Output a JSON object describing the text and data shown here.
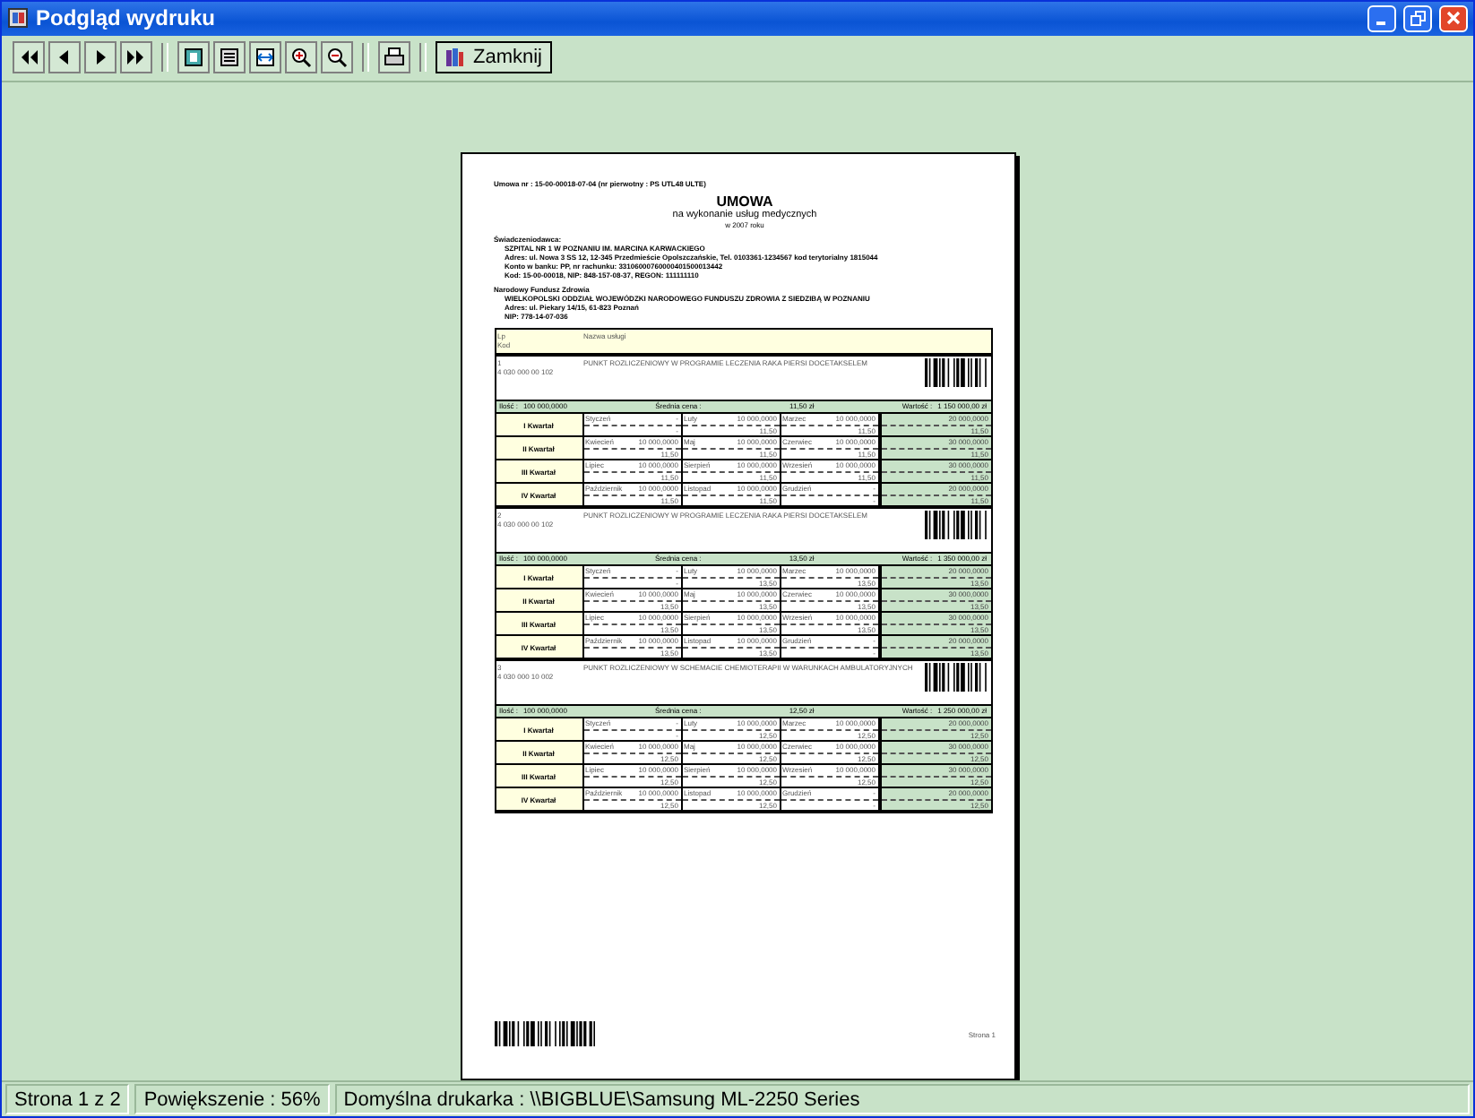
{
  "window": {
    "title": "Podgląd wydruku"
  },
  "toolbar": [
    {
      "kind": "first"
    },
    {
      "kind": "prev"
    },
    {
      "kind": "next"
    },
    {
      "kind": "last"
    },
    {
      "kind": "separator"
    },
    {
      "kind": "one-page"
    },
    {
      "kind": "two-page"
    },
    {
      "kind": "fit"
    },
    {
      "kind": "zoom-in"
    },
    {
      "kind": "zoom-out"
    },
    {
      "kind": "separator"
    },
    {
      "kind": "print"
    },
    {
      "kind": "separator"
    },
    {
      "kind": "close",
      "label": "Zamknij"
    }
  ],
  "document": {
    "reference": "Umowa nr : 15-00-00018-07-04 (nr pierwotny : PS UTL48 ULTE)",
    "title": "UMOWA",
    "subtitle": "na wykonanie usług medycznych",
    "year": "w 2007 roku",
    "provider": {
      "heading": "Świadczeniodawca:",
      "lines": [
        "SZPITAL NR 1 W POZNANIU IM. MARCINA KARWACKIEGO",
        "Adres: ul. Nowa 3 SS 12, 12-345 Przedmieście Opolszczańskie, Tel. 0103361-1234567    kod terytorialny 1815044",
        "Konto w banku: PP, nr rachunku: 33106000760000401500013442",
        "Kod: 15-00-00018, NIP: 848-157-08-37, REGON: 111111110"
      ]
    },
    "payer": {
      "heading": "Narodowy Fundusz Zdrowia",
      "lines": [
        "WIELKOPOLSKI ODDZIAŁ WOJEWÓDZKI NARODOWEGO FUNDUSZU ZDROWIA Z SIEDZIBĄ W POZNANIU",
        "Adres: ul. Piekary 14/15, 61-823 Poznań",
        "NIP: 778-14-07-036"
      ]
    },
    "table": {
      "columns": [
        "Lp",
        "Kod",
        "Nazwa usługi"
      ],
      "items": [
        {
          "lp": "1",
          "code": "4 030 000 00 102",
          "name": "PUNKT ROZLICZENIOWY W PROGRAMIE LECZENIA RAKA PIERSI DOCETAKSELEM",
          "qty_label": "Ilość :",
          "qty": "100 000,0000",
          "avg_label": "Średnia cena :",
          "avg": "11,50 zł",
          "value_label": "Wartość :",
          "value": "1 150 000,00 zł",
          "quarters": [
            {
              "label": "I Kwartał",
              "total_qty": "20 000,0000",
              "total_price": "11,50",
              "months": [
                {
                  "month": "Styczeń",
                  "qty": "-",
                  "price": "-"
                },
                {
                  "month": "Luty",
                  "qty": "10 000,0000",
                  "price": "11,50"
                },
                {
                  "month": "Marzec",
                  "qty": "10 000,0000",
                  "price": "11,50"
                }
              ]
            },
            {
              "label": "II Kwartał",
              "total_qty": "30 000,0000",
              "total_price": "11,50",
              "months": [
                {
                  "month": "Kwiecień",
                  "qty": "10 000,0000",
                  "price": "11,50"
                },
                {
                  "month": "Maj",
                  "qty": "10 000,0000",
                  "price": "11,50"
                },
                {
                  "month": "Czerwiec",
                  "qty": "10 000,0000",
                  "price": "11,50"
                }
              ]
            },
            {
              "label": "III Kwartał",
              "total_qty": "30 000,0000",
              "total_price": "11,50",
              "months": [
                {
                  "month": "Lipiec",
                  "qty": "10 000,0000",
                  "price": "11,50"
                },
                {
                  "month": "Sierpień",
                  "qty": "10 000,0000",
                  "price": "11,50"
                },
                {
                  "month": "Wrzesień",
                  "qty": "10 000,0000",
                  "price": "11,50"
                }
              ]
            },
            {
              "label": "IV Kwartał",
              "total_qty": "20 000,0000",
              "total_price": "11,50",
              "months": [
                {
                  "month": "Październik",
                  "qty": "10 000,0000",
                  "price": "11,50"
                },
                {
                  "month": "Listopad",
                  "qty": "10 000,0000",
                  "price": "11,50"
                },
                {
                  "month": "Grudzień",
                  "qty": "-",
                  "price": "-"
                }
              ]
            }
          ]
        },
        {
          "lp": "2",
          "code": "4 030 000 00 102",
          "name": "PUNKT ROZLICZENIOWY W PROGRAMIE LECZENIA RAKA PIERSI DOCETAKSELEM",
          "qty_label": "Ilość :",
          "qty": "100 000,0000",
          "avg_label": "Średnia cena :",
          "avg": "13,50 zł",
          "value_label": "Wartość :",
          "value": "1 350 000,00 zł",
          "quarters": [
            {
              "label": "I Kwartał",
              "total_qty": "20 000,0000",
              "total_price": "13,50",
              "months": [
                {
                  "month": "Styczeń",
                  "qty": "-",
                  "price": "-"
                },
                {
                  "month": "Luty",
                  "qty": "10 000,0000",
                  "price": "13,50"
                },
                {
                  "month": "Marzec",
                  "qty": "10 000,0000",
                  "price": "13,50"
                }
              ]
            },
            {
              "label": "II Kwartał",
              "total_qty": "30 000,0000",
              "total_price": "13,50",
              "months": [
                {
                  "month": "Kwiecień",
                  "qty": "10 000,0000",
                  "price": "13,50"
                },
                {
                  "month": "Maj",
                  "qty": "10 000,0000",
                  "price": "13,50"
                },
                {
                  "month": "Czerwiec",
                  "qty": "10 000,0000",
                  "price": "13,50"
                }
              ]
            },
            {
              "label": "III Kwartał",
              "total_qty": "30 000,0000",
              "total_price": "13,50",
              "months": [
                {
                  "month": "Lipiec",
                  "qty": "10 000,0000",
                  "price": "13,50"
                },
                {
                  "month": "Sierpień",
                  "qty": "10 000,0000",
                  "price": "13,50"
                },
                {
                  "month": "Wrzesień",
                  "qty": "10 000,0000",
                  "price": "13,50"
                }
              ]
            },
            {
              "label": "IV Kwartał",
              "total_qty": "20 000,0000",
              "total_price": "13,50",
              "months": [
                {
                  "month": "Październik",
                  "qty": "10 000,0000",
                  "price": "13,50"
                },
                {
                  "month": "Listopad",
                  "qty": "10 000,0000",
                  "price": "13,50"
                },
                {
                  "month": "Grudzień",
                  "qty": "-",
                  "price": "-"
                }
              ]
            }
          ]
        },
        {
          "lp": "3",
          "code": "4 030 000 10 002",
          "name": "PUNKT ROZLICZENIOWY W SCHEMACIE CHEMIOTERAPII W WARUNKACH AMBULATORYJNYCH",
          "qty_label": "Ilość :",
          "qty": "100 000,0000",
          "avg_label": "Średnia cena :",
          "avg": "12,50 zł",
          "value_label": "Wartość :",
          "value": "1 250 000,00 zł",
          "quarters": [
            {
              "label": "I Kwartał",
              "total_qty": "20 000,0000",
              "total_price": "12,50",
              "months": [
                {
                  "month": "Styczeń",
                  "qty": "-",
                  "price": "-"
                },
                {
                  "month": "Luty",
                  "qty": "10 000,0000",
                  "price": "12,50"
                },
                {
                  "month": "Marzec",
                  "qty": "10 000,0000",
                  "price": "12,50"
                }
              ]
            },
            {
              "label": "II Kwartał",
              "total_qty": "30 000,0000",
              "total_price": "12,50",
              "months": [
                {
                  "month": "Kwiecień",
                  "qty": "10 000,0000",
                  "price": "12,50"
                },
                {
                  "month": "Maj",
                  "qty": "10 000,0000",
                  "price": "12,50"
                },
                {
                  "month": "Czerwiec",
                  "qty": "10 000,0000",
                  "price": "12,50"
                }
              ]
            },
            {
              "label": "III Kwartał",
              "total_qty": "30 000,0000",
              "total_price": "12,50",
              "months": [
                {
                  "month": "Lipiec",
                  "qty": "10 000,0000",
                  "price": "12,50"
                },
                {
                  "month": "Sierpień",
                  "qty": "10 000,0000",
                  "price": "12,50"
                },
                {
                  "month": "Wrzesień",
                  "qty": "10 000,0000",
                  "price": "12,50"
                }
              ]
            },
            {
              "label": "IV Kwartał",
              "total_qty": "20 000,0000",
              "total_price": "12,50",
              "months": [
                {
                  "month": "Październik",
                  "qty": "10 000,0000",
                  "price": "12,50"
                },
                {
                  "month": "Listopad",
                  "qty": "10 000,0000",
                  "price": "12,50"
                },
                {
                  "month": "Grudzień",
                  "qty": "-",
                  "price": "-"
                }
              ]
            }
          ]
        }
      ]
    },
    "page_number": "Strona 1"
  },
  "status_bar": [
    "Strona 1 z 2",
    "Powiększenie : 56%",
    "Domyślna drukarka : \\\\BIGBLUE\\Samsung ML-2250 Series"
  ]
}
